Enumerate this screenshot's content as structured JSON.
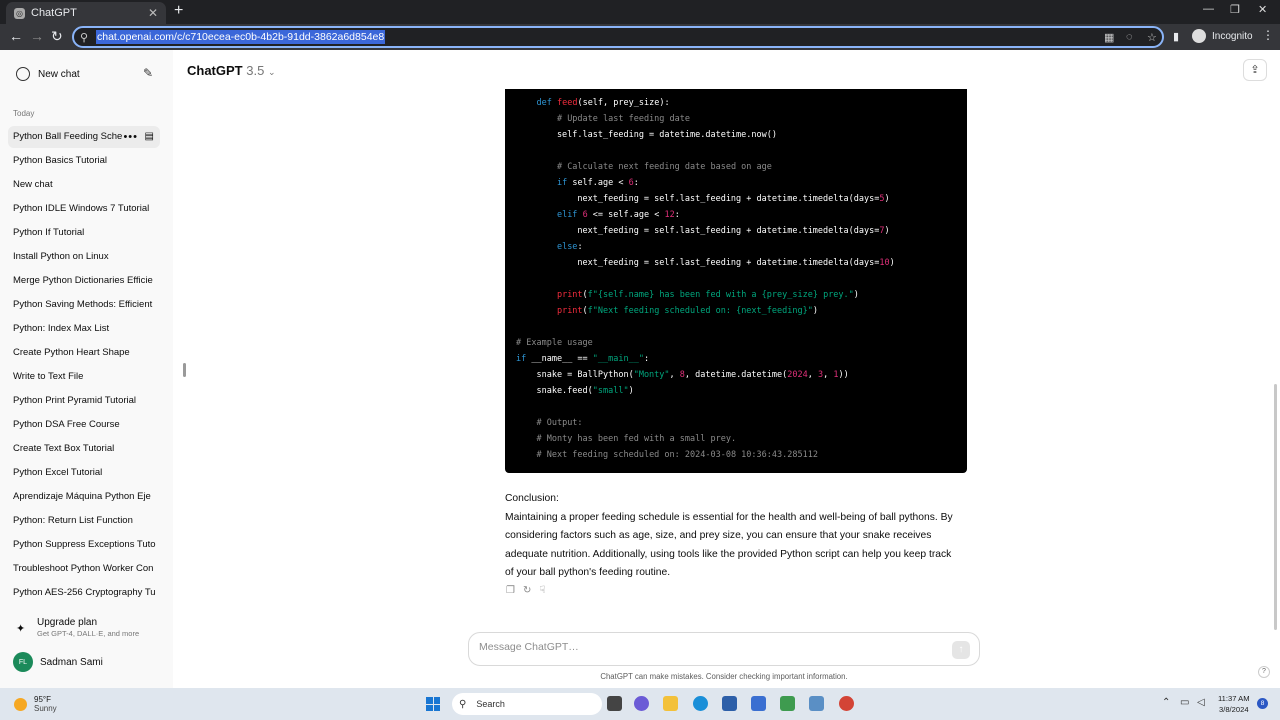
{
  "browser": {
    "tab_title": "ChatGPT",
    "url": "chat.openai.com/c/c710ecea-ec0b-4b2b-91dd-3862a6d854e8",
    "incognito_label": "Incognito"
  },
  "sidebar": {
    "new_chat": "New chat",
    "section": "Today",
    "items": [
      "Python Ball Feeding Sche",
      "Python Basics Tutorial",
      "New chat",
      "Python IDLE Windows 7 Tutorial",
      "Python If Tutorial",
      "Install Python on Linux",
      "Merge Python Dictionaries Efficie",
      "Python Saving Methods: Efficient",
      "Python: Index Max List",
      "Create Python Heart Shape",
      "Write to Text File",
      "Python Print Pyramid Tutorial",
      "Python DSA Free Course",
      "Create Text Box Tutorial",
      "Python Excel Tutorial",
      "Aprendizaje Máquina Python Eje",
      "Python: Return List Function",
      "Python Suppress Exceptions Tuto",
      "Troubleshoot Python Worker Con",
      "Python AES-256 Cryptography Tu"
    ],
    "upgrade_title": "Upgrade plan",
    "upgrade_sub": "Get GPT-4, DALL·E, and more",
    "user_initials": "FL",
    "user_name": "Sadman Sami"
  },
  "header": {
    "model": "ChatGPT",
    "version": "3.5"
  },
  "code_lines": [
    "    def feed(self, prey_size):",
    "        # Update last feeding date",
    "        self.last_feeding = datetime.datetime.now()",
    "",
    "        # Calculate next feeding date based on age",
    "        if self.age < 6:",
    "            next_feeding = self.last_feeding + datetime.timedelta(days=5)",
    "        elif 6 <= self.age < 12:",
    "            next_feeding = self.last_feeding + datetime.timedelta(days=7)",
    "        else:",
    "            next_feeding = self.last_feeding + datetime.timedelta(days=10)",
    "",
    "        print(f\"{self.name} has been fed with a {prey_size} prey.\")",
    "        print(f\"Next feeding scheduled on: {next_feeding}\")",
    "",
    "# Example usage",
    "if __name__ == \"__main__\":",
    "    snake = BallPython(\"Monty\", 8, datetime.datetime(2024, 3, 1))",
    "    snake.feed(\"small\")",
    "",
    "    # Output:",
    "    # Monty has been fed with a small prey.",
    "    # Next feeding scheduled on: 2024-03-08 10:36:43.285112"
  ],
  "conclusion": {
    "heading": "Conclusion:",
    "body": "Maintaining a proper feeding schedule is essential for the health and well-being of ball pythons. By considering factors such as age, size, and prey size, you can ensure that your snake receives adequate nutrition. Additionally, using tools like the provided Python script can help you keep track of your ball python's feeding routine."
  },
  "composer": {
    "placeholder": "Message ChatGPT…"
  },
  "disclaimer": "ChatGPT can make mistakes. Consider checking important information.",
  "taskbar": {
    "temp": "95°F",
    "condition": "Sunny",
    "search": "Search",
    "time": "11:37 AM",
    "date": "3/8/2024",
    "notifications": "8"
  }
}
